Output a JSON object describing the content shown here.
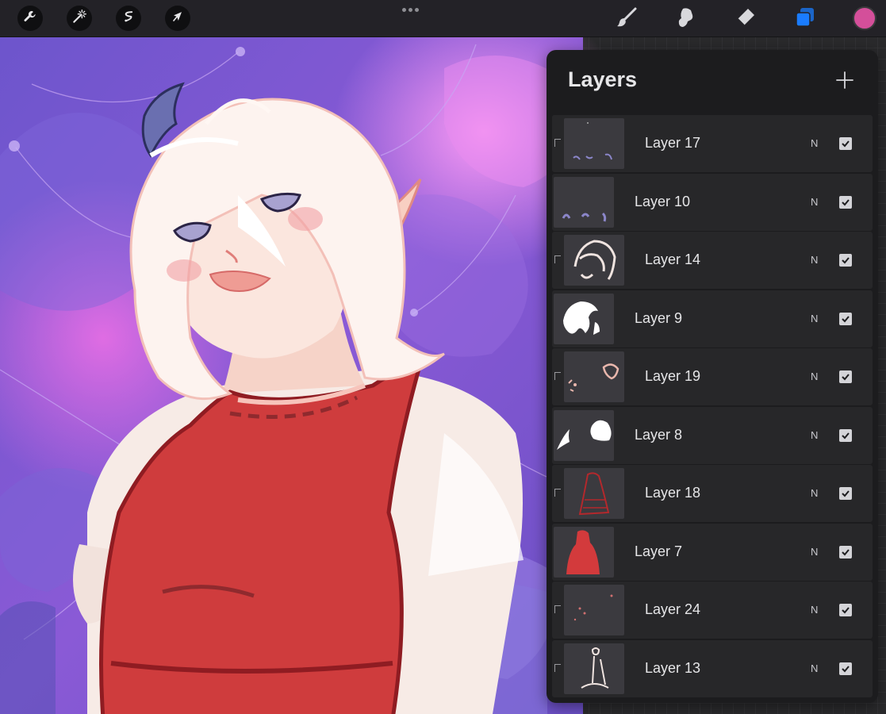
{
  "toolbar": {
    "left_tools": [
      {
        "name": "wrench-icon",
        "label": "Actions"
      },
      {
        "name": "magic-wand-icon",
        "label": "Adjustments"
      },
      {
        "name": "selection-icon",
        "label": "Selection"
      },
      {
        "name": "arrow-cursor-icon",
        "label": "Transform"
      }
    ],
    "right_tools": [
      {
        "name": "brush-icon",
        "label": "Paint"
      },
      {
        "name": "smudge-icon",
        "label": "Smudge"
      },
      {
        "name": "eraser-icon",
        "label": "Erase"
      },
      {
        "name": "layers-icon",
        "label": "Layers",
        "active": true
      }
    ],
    "current_color": "#d44f9a",
    "active_tool_color": "#1a7cff"
  },
  "layers_panel": {
    "title": "Layers",
    "layers": [
      {
        "name": "Layer 17",
        "blend": "N",
        "visible": true,
        "clipped": true
      },
      {
        "name": "Layer 10",
        "blend": "N",
        "visible": true,
        "clipped": false
      },
      {
        "name": "Layer 14",
        "blend": "N",
        "visible": true,
        "clipped": true
      },
      {
        "name": "Layer 9",
        "blend": "N",
        "visible": true,
        "clipped": false
      },
      {
        "name": "Layer 19",
        "blend": "N",
        "visible": true,
        "clipped": true
      },
      {
        "name": "Layer 8",
        "blend": "N",
        "visible": true,
        "clipped": false
      },
      {
        "name": "Layer 18",
        "blend": "N",
        "visible": true,
        "clipped": true
      },
      {
        "name": "Layer 7",
        "blend": "N",
        "visible": true,
        "clipped": false
      },
      {
        "name": "Layer 24",
        "blend": "N",
        "visible": true,
        "clipped": true
      },
      {
        "name": "Layer 13",
        "blend": "N",
        "visible": true,
        "clipped": true
      }
    ]
  }
}
